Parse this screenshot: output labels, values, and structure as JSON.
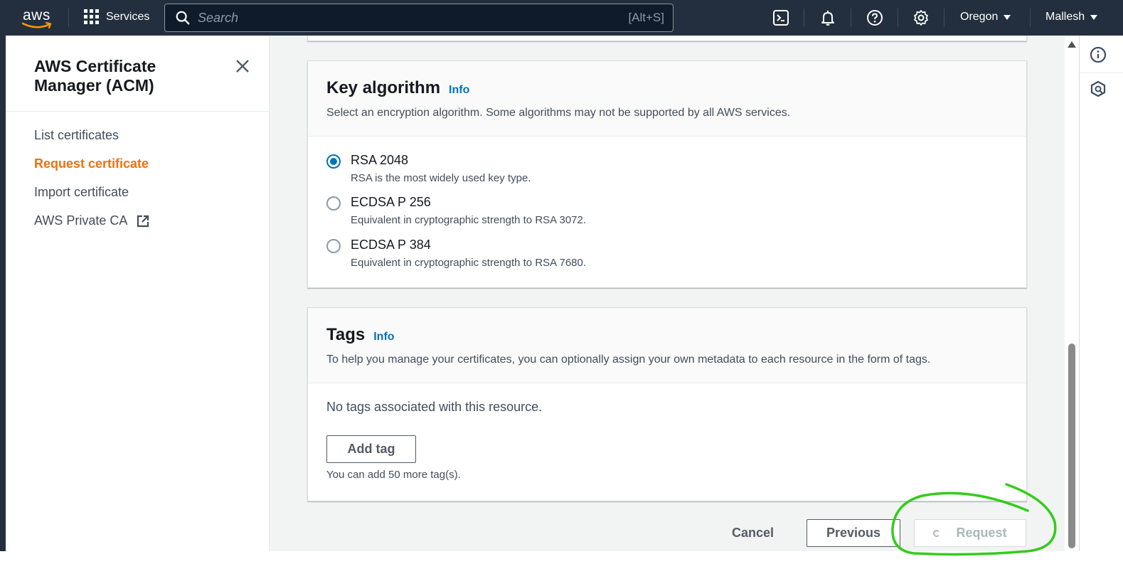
{
  "topnav": {
    "logo_text": "aws",
    "services_label": "Services",
    "search_placeholder": "Search",
    "search_shortcut": "[Alt+S]",
    "region_label": "Oregon",
    "user_label": "Mallesh"
  },
  "sidenav": {
    "title": "AWS Certificate Manager (ACM)",
    "items": [
      {
        "label": "List certificates",
        "active": false
      },
      {
        "label": "Request certificate",
        "active": true
      },
      {
        "label": "Import certificate",
        "active": false
      },
      {
        "label": "AWS Private CA",
        "active": false,
        "external": true
      }
    ]
  },
  "key_algorithm": {
    "title": "Key algorithm",
    "info_label": "Info",
    "description": "Select an encryption algorithm. Some algorithms may not be supported by all AWS services.",
    "options": [
      {
        "label": "RSA 2048",
        "description": "RSA is the most widely used key type.",
        "selected": true
      },
      {
        "label": "ECDSA P 256",
        "description": "Equivalent in cryptographic strength to RSA 3072.",
        "selected": false
      },
      {
        "label": "ECDSA P 384",
        "description": "Equivalent in cryptographic strength to RSA 7680.",
        "selected": false
      }
    ]
  },
  "tags": {
    "title": "Tags",
    "info_label": "Info",
    "description": "To help you manage your certificates, you can optionally assign your own metadata to each resource in the form of tags.",
    "empty_text": "No tags associated with this resource.",
    "add_tag_label": "Add tag",
    "limit_text": "You can add 50 more tag(s)."
  },
  "actions": {
    "cancel_label": "Cancel",
    "previous_label": "Previous",
    "request_label": "Request"
  },
  "colors": {
    "nav_bg": "#232f3e",
    "active_link": "#ec7211",
    "info_link": "#0073bb",
    "annotation": "#33cc1a"
  }
}
